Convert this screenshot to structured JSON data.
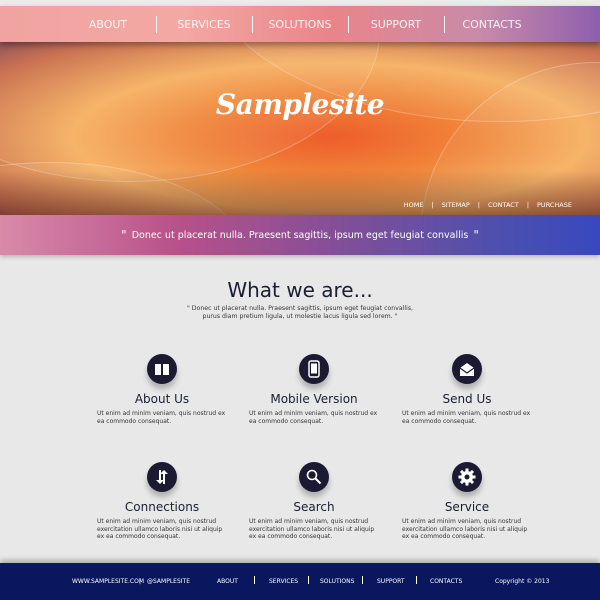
{
  "nav": {
    "items": [
      "ABOUT",
      "SERVICES",
      "SOLUTIONS",
      "SUPPORT",
      "CONTACTS"
    ]
  },
  "hero": {
    "logo": "Samplesite",
    "subnav": [
      "HOME",
      "SITEMAP",
      "CONTACT",
      "PURCHASE"
    ],
    "quote": "Donec ut placerat nulla. Praesent sagittis, ipsum eget feugiat convallis"
  },
  "main": {
    "title": "What we are...",
    "intro_line1": "Donec ut placerat nulla. Praesent sagittis, ipsum eget feugiat convallis,",
    "intro_line2": "purus diam pretium ligula, ut molestie lacus ligula sed lorem.",
    "features": [
      {
        "icon": "book-icon",
        "title": "About Us",
        "text": "Ut enim ad minim veniam, quis nostrud ex ea commodo consequat."
      },
      {
        "icon": "mobile-icon",
        "title": "Mobile Version",
        "text": "Ut enim ad minim veniam, quis nostrud ex ea commodo consequat."
      },
      {
        "icon": "envelope-icon",
        "title": "Send Us",
        "text": "Ut enim ad minim veniam, quis nostrud ex ea commodo consequat."
      },
      {
        "icon": "arrows-icon",
        "title": "Connections",
        "text": "Ut enim ad minim veniam, quis nostrud exercitation ullamco laboris nisi ut aliquip ex ea commodo consequat."
      },
      {
        "icon": "search-icon",
        "title": "Search",
        "text": "Ut enim ad minim veniam, quis nostrud exercitation ullamco laboris nisi ut aliquip ex ea commodo consequat."
      },
      {
        "icon": "gear-icon",
        "title": "Service",
        "text": "Ut enim ad minim veniam, quis nostrud exercitation ullamco laboris nisi ut aliquip ex ea commodo consequat."
      }
    ]
  },
  "footer": {
    "website": "WWW.SAMPLESITE.COM",
    "handle": "@SAMPLESITE",
    "links": [
      "ABOUT",
      "SERVICES",
      "SOLUTIONS",
      "SUPPORT",
      "CONTACTS"
    ],
    "copyright": "Copyright © 2013"
  },
  "colors": {
    "footer": "#0a175e",
    "icon_bg": "#1c1a33",
    "page_bg": "#e8e8e8"
  }
}
